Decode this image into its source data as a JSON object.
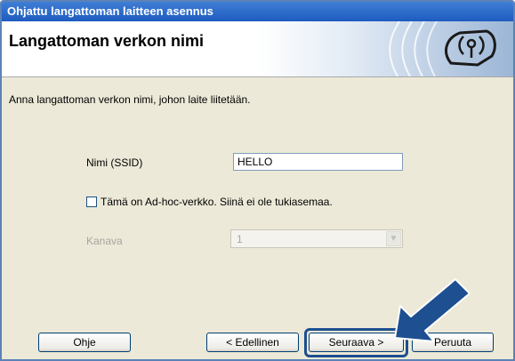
{
  "window": {
    "title": "Ohjattu langattoman laitteen asennus"
  },
  "header": {
    "title": "Langattoman verkon nimi"
  },
  "instruction": "Anna langattoman verkon nimi, johon laite liitetään.",
  "form": {
    "ssid_label": "Nimi (SSID)",
    "ssid_value": "HELLO",
    "adhoc_label": "Tämä on Ad-hoc-verkko. Siinä ei ole tukiasemaa.",
    "adhoc_checked": false,
    "channel_label": "Kanava",
    "channel_value": "1"
  },
  "buttons": {
    "help": "Ohje",
    "back": "< Edellinen",
    "next": "Seuraava >",
    "cancel": "Peruuta"
  },
  "colors": {
    "titlebar": "#1e5bc0",
    "highlight": "#1d4f91",
    "arrow": "#1d4f91"
  },
  "icons": {
    "wireless": "wireless-antenna-icon",
    "pointer": "pointer-arrow-icon"
  }
}
